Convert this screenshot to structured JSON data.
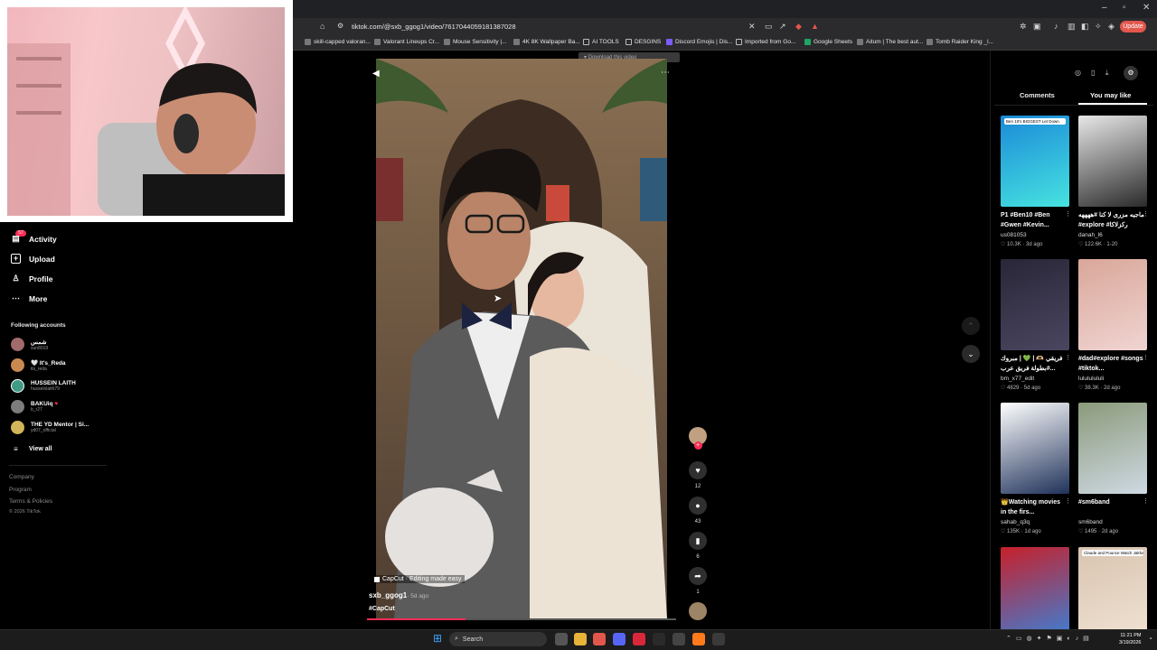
{
  "browser": {
    "url": "tiktok.com/@sxb_ggog1/video/7617044059181387028",
    "update_label": "Update",
    "bookmarks": [
      {
        "label": "skill-capped valoran..."
      },
      {
        "label": "Valorant Lineups Cr..."
      },
      {
        "label": "Mouse Sensitivity |..."
      },
      {
        "label": "4K 8K Wallpaper Ba..."
      },
      {
        "label": "AI TOOLS"
      },
      {
        "label": "DESGINS"
      },
      {
        "label": "Discord Emojis | Dis..."
      },
      {
        "label": "Imported from Go..."
      },
      {
        "label": "Google Sheets"
      },
      {
        "label": "Aitum | The best aut..."
      },
      {
        "label": "Tomb Raider King _l..."
      }
    ],
    "download_tooltip": "Download this video"
  },
  "sidebar": {
    "badge": "57",
    "nav": [
      {
        "label": "Activity",
        "icon": "bell-icon"
      },
      {
        "label": "Upload",
        "icon": "plus-square-icon"
      },
      {
        "label": "Profile",
        "icon": "person-icon"
      },
      {
        "label": "More",
        "icon": "more-icon"
      }
    ],
    "following_title": "Following accounts",
    "accounts": [
      {
        "name": "شمس",
        "handle": "sun8019"
      },
      {
        "name": "It's_Reda",
        "handle": "its_reda"
      },
      {
        "name": "HUSSEIN LAITH",
        "handle": "husseinlaith79"
      },
      {
        "name": "BAKUiq",
        "handle": "b_r27"
      },
      {
        "name": "THE YD Mentor | Si...",
        "handle": "yd07_official"
      }
    ],
    "view_all": "View all",
    "footer": [
      "Company",
      "Program",
      "Terms & Policies",
      "© 2026 TikTok"
    ]
  },
  "video": {
    "capcut_tag": "CapCut · Editing made easy",
    "author": "sxb_ggog1",
    "age": "· 5d ago",
    "hashtag": "#CapCut",
    "progress": 0.32,
    "actions": {
      "likes": "12",
      "comments": "43",
      "saves": "6",
      "shares": "1"
    }
  },
  "right_panel": {
    "tabs": [
      "Comments",
      "You may like"
    ],
    "active_tab": "You may like",
    "cards": [
      {
        "title": "P1 #Ben10 #Ben #Gwen #Kevin...",
        "user": "us081053",
        "likes": "10.3K",
        "age": "3d ago",
        "badge": "Ben 10's BIGGEST Let Down",
        "colors": [
          "#1b8ad8",
          "#46e3e0"
        ]
      },
      {
        "title": "ماجيه مزرى لا كنا #ههههه #explore #ركزلاكا",
        "user": "danah_l6",
        "likes": "122.6K",
        "age": "1-20",
        "badge": "",
        "colors": [
          "#e8e8e8",
          "#2a2a2a"
        ]
      },
      {
        "title": "فريقي 🫶🏼 | 💚 | مبروك #بطولة فريق عرب...",
        "user": "bm_x77_edit",
        "likes": "4829",
        "age": "5d ago",
        "badge": "",
        "colors": [
          "#2a2638",
          "#4a4660"
        ]
      },
      {
        "title": "#dad#explore #songs #tiktok...",
        "user": "lulululululi",
        "likes": "38.3K",
        "age": "2d ago",
        "badge": "",
        "colors": [
          "#d9a799",
          "#f0d4d2"
        ]
      },
      {
        "title": "👑Watching movies in the firs...",
        "user": "sahab_q3q",
        "likes": "135K",
        "age": "1d ago",
        "badge": "",
        "colors": [
          "#ffffff",
          "#20325a"
        ]
      },
      {
        "title": "#sm6band",
        "user": "sm6band",
        "likes": "1495",
        "age": "2d ago",
        "badge": "",
        "colors": [
          "#8a9a7a",
          "#cfd9e3"
        ]
      },
      {
        "title": "",
        "user": "",
        "likes": "",
        "age": "",
        "badge": "",
        "colors": [
          "#c8202a",
          "#3c7fd6"
        ]
      },
      {
        "title": "",
        "user": "",
        "likes": "",
        "age": "",
        "badge": "Claude and Pounce Watch Jakhag Ep 1",
        "colors": [
          "#d8c4b0",
          "#f0e2d2"
        ]
      }
    ]
  },
  "taskbar": {
    "search_label": "Search",
    "time": "11:21 PM",
    "date": "3/19/2026"
  },
  "colors": {
    "accent": "#fe2c55",
    "background": "#000000",
    "update": "#e2574c"
  }
}
